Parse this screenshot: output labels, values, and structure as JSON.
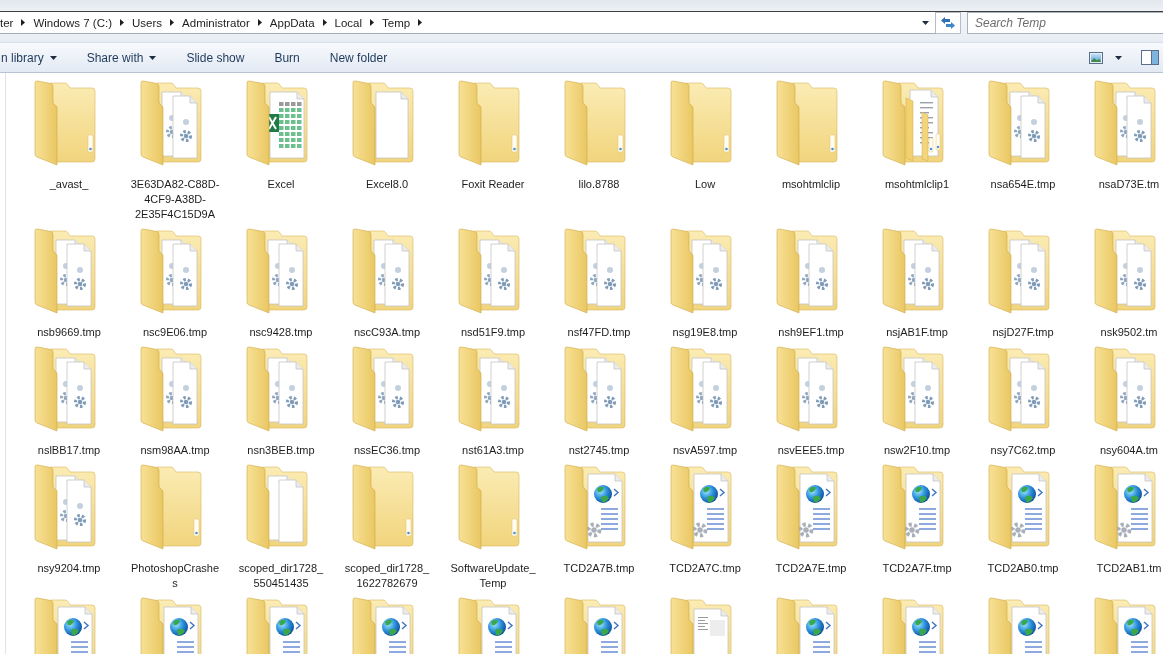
{
  "address_bar": {
    "breadcrumbs": [
      "ter",
      "Windows 7 (C:)",
      "Users",
      "Administrator",
      "AppData",
      "Local",
      "Temp"
    ]
  },
  "search": {
    "placeholder": "Search Temp"
  },
  "toolbar": {
    "buttons": [
      {
        "label": "n library",
        "dropdown": true
      },
      {
        "label": "Share with",
        "dropdown": true
      },
      {
        "label": "Slide show",
        "dropdown": false
      },
      {
        "label": "Burn",
        "dropdown": false
      },
      {
        "label": "New folder",
        "dropdown": false
      }
    ]
  },
  "items": [
    {
      "name": "_avast_",
      "kind": "empty",
      "selected": false
    },
    {
      "name": "3E63DA82-C88D-4CF9-A38D-2E35F4C15D9A",
      "kind": "setup",
      "selected": false
    },
    {
      "name": "Excel",
      "kind": "sheet",
      "selected": false
    },
    {
      "name": "Excel8.0",
      "kind": "page",
      "selected": false
    },
    {
      "name": "Foxit Reader",
      "kind": "empty",
      "selected": false
    },
    {
      "name": "lilo.8788",
      "kind": "empty",
      "selected": false
    },
    {
      "name": "Low",
      "kind": "empty",
      "selected": false
    },
    {
      "name": "msohtmlclip",
      "kind": "empty",
      "selected": false
    },
    {
      "name": "msohtmlclip1",
      "kind": "stack",
      "selected": false
    },
    {
      "name": "nsa654E.tmp",
      "kind": "setup",
      "selected": false
    },
    {
      "name": "nsaD73E.tm",
      "kind": "setup",
      "selected": false
    },
    {
      "name": "nsb9669.tmp",
      "kind": "setup",
      "selected": false
    },
    {
      "name": "nsc9E06.tmp",
      "kind": "setup",
      "selected": false
    },
    {
      "name": "nsc9428.tmp",
      "kind": "setup",
      "selected": false
    },
    {
      "name": "nscC93A.tmp",
      "kind": "setup",
      "selected": false
    },
    {
      "name": "nsd51F9.tmp",
      "kind": "setup",
      "selected": false
    },
    {
      "name": "nsf47FD.tmp",
      "kind": "setup",
      "selected": false
    },
    {
      "name": "nsg19E8.tmp",
      "kind": "setup",
      "selected": false
    },
    {
      "name": "nsh9EF1.tmp",
      "kind": "setup",
      "selected": false
    },
    {
      "name": "nsjAB1F.tmp",
      "kind": "setup",
      "selected": false
    },
    {
      "name": "nsjD27F.tmp",
      "kind": "setup",
      "selected": false
    },
    {
      "name": "nsk9502.tm",
      "kind": "setup",
      "selected": false
    },
    {
      "name": "nslBB17.tmp",
      "kind": "setup",
      "selected": false
    },
    {
      "name": "nsm98AA.tmp",
      "kind": "setup",
      "selected": false
    },
    {
      "name": "nsn3BEB.tmp",
      "kind": "setup",
      "selected": false
    },
    {
      "name": "nssEC36.tmp",
      "kind": "setup",
      "selected": false
    },
    {
      "name": "nst61A3.tmp",
      "kind": "setup",
      "selected": false
    },
    {
      "name": "nst2745.tmp",
      "kind": "setup",
      "selected": false
    },
    {
      "name": "nsvA597.tmp",
      "kind": "setup",
      "selected": false
    },
    {
      "name": "nsvEEE5.tmp",
      "kind": "setup",
      "selected": false
    },
    {
      "name": "nsw2F10.tmp",
      "kind": "setup",
      "selected": false
    },
    {
      "name": "nsy7C62.tmp",
      "kind": "setup",
      "selected": false
    },
    {
      "name": "nsy604A.tm",
      "kind": "setup",
      "selected": false
    },
    {
      "name": "nsy9204.tmp",
      "kind": "setup",
      "selected": false
    },
    {
      "name": "PhotoshopCrashes",
      "kind": "empty",
      "selected": false
    },
    {
      "name": "scoped_dir1728_550451435",
      "kind": "pages",
      "selected": false
    },
    {
      "name": "scoped_dir1728_1622782679",
      "kind": "empty",
      "selected": false
    },
    {
      "name": "SoftwareUpdate_Temp",
      "kind": "empty",
      "selected": false
    },
    {
      "name": "TCD2A7B.tmp",
      "kind": "web",
      "selected": false
    },
    {
      "name": "TCD2A7C.tmp",
      "kind": "web",
      "selected": false
    },
    {
      "name": "TCD2A7E.tmp",
      "kind": "web",
      "selected": false
    },
    {
      "name": "TCD2A7F.tmp",
      "kind": "web",
      "selected": false
    },
    {
      "name": "TCD2AB0.tmp",
      "kind": "web",
      "selected": false
    },
    {
      "name": "TCD2AB1.tm",
      "kind": "web",
      "selected": false
    },
    {
      "kind": "web",
      "selected": false
    },
    {
      "kind": "web",
      "selected": false
    },
    {
      "kind": "web",
      "selected": false
    },
    {
      "kind": "web",
      "selected": false
    },
    {
      "kind": "web",
      "selected": false
    },
    {
      "kind": "web",
      "selected": false
    },
    {
      "kind": "form",
      "selected": false
    },
    {
      "kind": "web",
      "selected": false
    },
    {
      "kind": "web",
      "selected": false
    },
    {
      "kind": "web",
      "selected": false
    },
    {
      "kind": "web",
      "selected": false
    }
  ]
}
